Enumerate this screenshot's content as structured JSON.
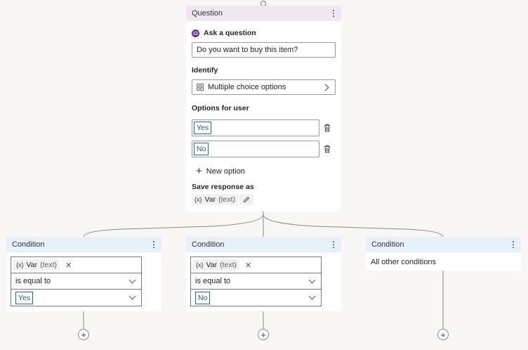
{
  "question_card": {
    "title": "Question",
    "ask_label": "Ask a question",
    "question_value": "Do you want to buy this item?",
    "identify_label": "Identify",
    "identify_value": "Multiple choice options",
    "options_label": "Options for user",
    "options": [
      "Yes",
      "No"
    ],
    "new_option_label": "New option",
    "save_label": "Save response as",
    "var_icon": "{x}",
    "var_name": "Var",
    "var_type": "(text)"
  },
  "conditions": [
    {
      "title": "Condition",
      "var_icon": "{x}",
      "var_name": "Var",
      "var_type": "(text)",
      "operator": "is equal to",
      "value": "Yes"
    },
    {
      "title": "Condition",
      "var_icon": "{x}",
      "var_name": "Var",
      "var_type": "(text)",
      "operator": "is equal to",
      "value": "No"
    },
    {
      "title": "Condition",
      "text": "All other conditions"
    }
  ],
  "colors": {
    "question_header": "#f0e8f1",
    "condition_header": "#e6f1fb",
    "ask_icon": "#6b2c91",
    "option_tag_border": "#1e6f8c"
  },
  "icons": {
    "add": "+",
    "close": "✕"
  }
}
